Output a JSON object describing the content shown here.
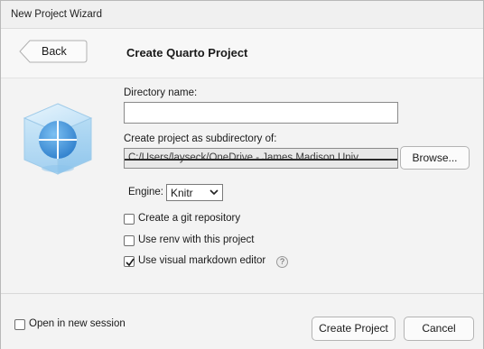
{
  "window": {
    "title": "New Project Wizard"
  },
  "header": {
    "back_label": "Back",
    "heading": "Create Quarto Project"
  },
  "form": {
    "directory_label": "Directory name:",
    "directory_value": "",
    "parent_label": "Create project as subdirectory of:",
    "parent_path": "C:/Users/layseck/OneDrive - James Madison Univ",
    "browse_label": "Browse...",
    "engine_label": "Engine:",
    "engine_value": "Knitr",
    "options": [
      {
        "label": "Create a git repository",
        "checked": false
      },
      {
        "label": "Use renv with this project",
        "checked": false
      },
      {
        "label": "Use visual markdown editor",
        "checked": true
      }
    ],
    "help_glyph": "?"
  },
  "footer": {
    "open_new_session_label": "Open in new session",
    "open_new_session_checked": false,
    "create_label": "Create Project",
    "cancel_label": "Cancel"
  },
  "icons": {
    "back": "chevron-left-icon",
    "project": "quarto-project-cube-icon",
    "dropdown": "chevron-down-icon",
    "check": "checkmark-icon",
    "help": "help-icon"
  },
  "colors": {
    "cube_globe": "#3d8fd6",
    "cube_glass": "#a9d3f2"
  }
}
